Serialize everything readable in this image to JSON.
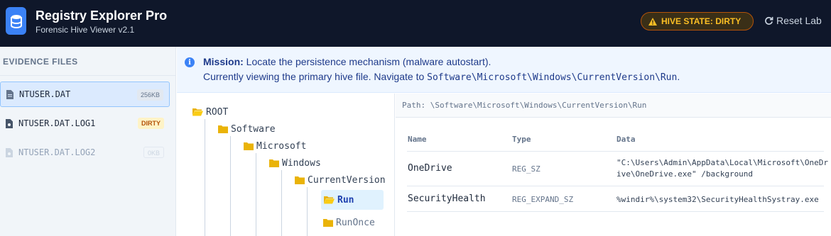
{
  "header": {
    "title": "Registry Explorer Pro",
    "subtitle": "Forensic Hive Viewer v2.1",
    "hive_state": "HIVE STATE: DIRTY",
    "reset_label": "Reset Lab",
    "accent": "#3b82f6"
  },
  "sidebar": {
    "title": "EVIDENCE FILES",
    "files": [
      {
        "name": "NTUSER.DAT",
        "badge": "256KB",
        "state": "active"
      },
      {
        "name": "NTUSER.DAT.LOG1",
        "badge": "DIRTY",
        "state": "normal"
      },
      {
        "name": "NTUSER.DAT.LOG2",
        "badge": "0KB",
        "state": "disabled"
      }
    ]
  },
  "mission": {
    "label": "Mission:",
    "text": "Locate the persistence mechanism (malware autostart).",
    "line2_prefix": "Currently viewing the primary hive file. Navigate to",
    "line2_path": "Software\\Microsoft\\Windows\\CurrentVersion\\Run",
    "line2_suffix": "."
  },
  "tree": {
    "nodes": [
      {
        "label": "ROOT",
        "open": true
      },
      {
        "label": "Software",
        "open": false
      },
      {
        "label": "Microsoft",
        "open": false
      },
      {
        "label": "Windows",
        "open": false
      },
      {
        "label": "CurrentVersion",
        "open": false
      },
      {
        "label": "Run",
        "open": true,
        "selected": true
      },
      {
        "label": "RunOnce",
        "open": false
      }
    ]
  },
  "detail": {
    "path": "Path: \\Software\\Microsoft\\Windows\\CurrentVersion\\Run",
    "columns": [
      "Name",
      "Type",
      "Data"
    ],
    "rows": [
      {
        "name": "OneDrive",
        "type": "REG_SZ",
        "data": "\"C:\\Users\\Admin\\AppData\\Local\\Microsoft\\OneDrive\\OneDrive.exe\" /background"
      },
      {
        "name": "SecurityHealth",
        "type": "REG_EXPAND_SZ",
        "data": "%windir%\\system32\\SecurityHealthSystray.exe"
      }
    ]
  }
}
